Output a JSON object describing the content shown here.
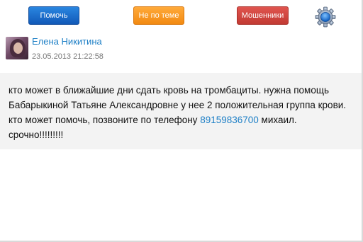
{
  "toolbar": {
    "help_label": "Помочь",
    "offtopic_label": "Не по теме",
    "scam_label": "Мошенники"
  },
  "post": {
    "author": "Елена Никитина",
    "timestamp": "23.05.2013 21:22:58",
    "text_before_phone": "кто может в ближайшие дни сдать кровь на тромбациты. нужна помощь Бабарыкиной Татьяне Александровне у нее 2 положительная группа крови. кто может помочь, позвоните по телефону ",
    "phone": "89159836700",
    "text_after_phone": " михаил. срочно!!!!!!!!!"
  },
  "icons": {
    "settings": "gear-icon"
  },
  "colors": {
    "help_button": "#1f6fd0",
    "offtopic_button": "#f7961e",
    "scam_button": "#d2453f",
    "link": "#1d7fc6",
    "message_background": "#f3f3f3"
  }
}
